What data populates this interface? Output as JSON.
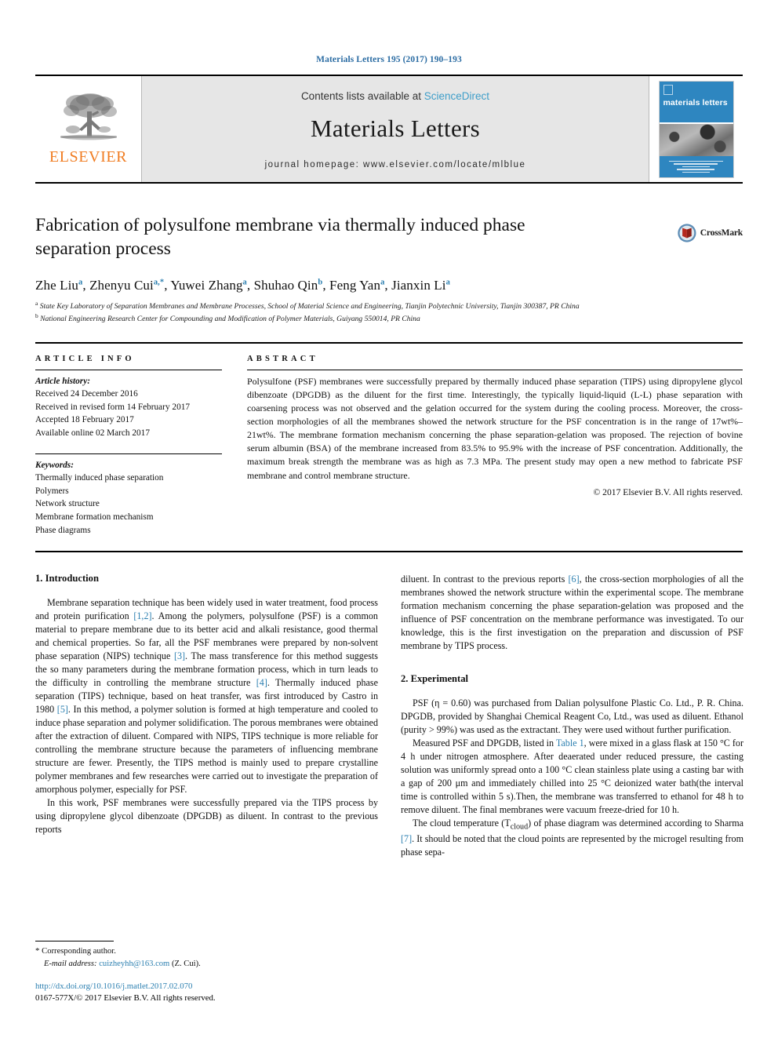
{
  "running_head": "Materials Letters 195 (2017) 190–193",
  "masthead": {
    "publisher_name": "ELSEVIER",
    "contents_prefix": "Contents lists available at ",
    "contents_link": "ScienceDirect",
    "journal_title": "Materials Letters",
    "journal_homepage": "journal homepage: www.elsevier.com/locate/mlblue",
    "cover_title": "materials letters"
  },
  "article": {
    "title": "Fabrication of polysulfone membrane via thermally induced phase separation process",
    "crossmark_label": "CrossMark",
    "authors": [
      {
        "name": "Zhe Liu",
        "sup": "a"
      },
      {
        "name": "Zhenyu Cui",
        "sup": "a,*"
      },
      {
        "name": "Yuwei Zhang",
        "sup": "a"
      },
      {
        "name": "Shuhao Qin",
        "sup": "b"
      },
      {
        "name": "Feng Yan",
        "sup": "a"
      },
      {
        "name": "Jianxin Li",
        "sup": "a"
      }
    ],
    "affiliations": [
      {
        "mark": "a",
        "text": "State Key Laboratory of Separation Membranes and Membrane Processes, School of Material Science and Engineering, Tianjin Polytechnic University, Tianjin 300387, PR China"
      },
      {
        "mark": "b",
        "text": "National Engineering Research Center for Compounding and Modification of Polymer Materials, Guiyang 550014, PR China"
      }
    ]
  },
  "info": {
    "label": "ARTICLE INFO",
    "history_head": "Article history:",
    "history": [
      "Received 24 December 2016",
      "Received in revised form 14 February 2017",
      "Accepted 18 February 2017",
      "Available online 02 March 2017"
    ],
    "keywords_head": "Keywords:",
    "keywords": [
      "Thermally induced phase separation",
      "Polymers",
      "Network structure",
      "Membrane formation mechanism",
      "Phase diagrams"
    ]
  },
  "abstract": {
    "label": "ABSTRACT",
    "text": "Polysulfone (PSF) membranes were successfully prepared by thermally induced phase separation (TIPS) using dipropylene glycol dibenzoate (DPGDB) as the diluent for the first time. Interestingly, the typically liquid-liquid (L-L) phase separation with coarsening process was not observed and the gelation occurred for the system during the cooling process. Moreover, the cross-section morphologies of all the membranes showed the network structure for the PSF concentration is in the range of 17wt%–21wt%. The membrane formation mechanism concerning the phase separation-gelation was proposed. The rejection of bovine serum albumin (BSA) of the membrane increased from 83.5% to 95.9% with the increase of PSF concentration. Additionally, the maximum break strength the membrane was as high as 7.3 MPa. The present study may open a new method to fabricate PSF membrane and control membrane structure.",
    "copyright": "© 2017 Elsevier B.V. All rights reserved."
  },
  "sections": {
    "introduction_heading": "1. Introduction",
    "intro_p1_a": "Membrane separation technique has been widely used in water treatment, food process and protein purification ",
    "intro_p1_r1": "[1,2]",
    "intro_p1_b": ". Among the polymers, polysulfone (PSF) is a common material to prepare membrane due to its better acid and alkali resistance, good thermal and chemical properties. So far, all the PSF membranes were prepared by non-solvent phase separation (NIPS) technique ",
    "intro_p1_r2": "[3]",
    "intro_p1_c": ". The mass transference for this method suggests the so many parameters during the membrane formation process, which in turn leads to the difficulty in controlling the membrane structure ",
    "intro_p1_r3": "[4]",
    "intro_p1_d": ". Thermally induced phase separation (TIPS) technique, based on heat transfer, was first introduced by Castro in 1980 ",
    "intro_p1_r4": "[5]",
    "intro_p1_e": ". In this method, a polymer solution is formed at high temperature and cooled to induce phase separation and polymer solidification. The porous membranes were obtained after the extraction of diluent. Compared with NIPS, TIPS technique is more reliable for controlling the membrane structure because the parameters of influencing membrane structure are fewer. Presently, the TIPS method is mainly used to prepare crystalline polymer membranes and few researches were carried out to investigate the preparation of amorphous polymer, especially for PSF.",
    "intro_p2_a": "In this work, PSF membranes were successfully prepared via the TIPS process by using dipropylene glycol dibenzoate (DPGDB) as diluent. In contrast to the previous reports ",
    "intro_p2_r1": "[6]",
    "intro_p2_b": ", the cross-section morphologies of all the membranes showed the network structure within the experimental scope. The membrane formation mechanism concerning the phase separation-gelation was proposed and the influence of PSF concentration on the membrane performance was investigated. To our knowledge, this is the first investigation on the preparation and discussion of PSF membrane by TIPS process.",
    "experimental_heading": "2. Experimental",
    "exp_p1": "PSF (η = 0.60) was purchased from Dalian polysulfone Plastic Co. Ltd., P. R. China. DPGDB, provided by Shanghai Chemical Reagent Co, Ltd., was used as diluent. Ethanol (purity > 99%) was used as the extractant. They were used without further purification.",
    "exp_p2_a": "Measured PSF and DPGDB, listed in ",
    "exp_p2_r1": "Table 1",
    "exp_p2_b": ", were mixed in a glass flask at 150 °C for 4 h under nitrogen atmosphere. After deaerated under reduced pressure, the casting solution was uniformly spread onto a 100 °C clean stainless plate using a casting bar with a gap of 200 μm and immediately chilled into 25 °C deionized water bath(the interval time is controlled within 5 s).Then, the membrane was transferred to ethanol for 48 h to remove diluent. The final membranes were vacuum freeze-dried for 10 h.",
    "exp_p3_a": "The cloud temperature (T",
    "exp_p3_sub": "cloud",
    "exp_p3_b": ") of phase diagram was determined according to Sharma ",
    "exp_p3_r1": "[7]",
    "exp_p3_c": ". It should be noted that the cloud points are represented by the microgel resulting from phase sepa-"
  },
  "footer": {
    "corresponding_marker": "*",
    "corresponding_label": "Corresponding author.",
    "email_label": "E-mail address:",
    "email": "cuizheyhh@163.com",
    "email_owner": "(Z. Cui).",
    "doi": "http://dx.doi.org/10.1016/j.matlet.2017.02.070",
    "issn_line": "0167-577X/© 2017 Elsevier B.V. All rights reserved."
  },
  "colors": {
    "link_blue": "#2b7fb0",
    "sciencedirect_blue": "#3e9ec9",
    "elsevier_orange": "#f07c21",
    "cover_blue": "#2e86c0"
  }
}
